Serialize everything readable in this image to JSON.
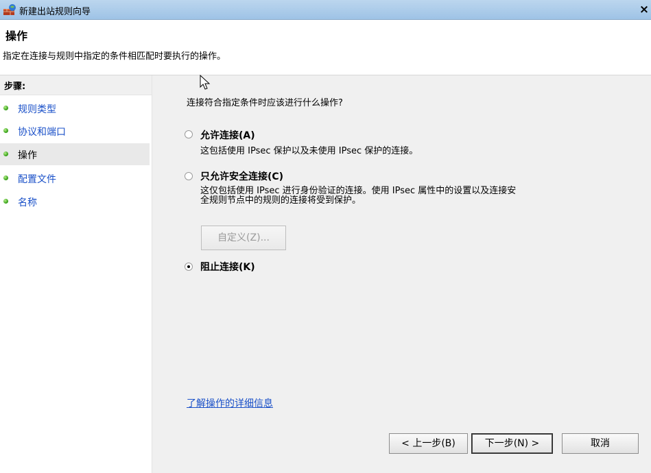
{
  "window": {
    "title": "新建出站规则向导",
    "close_symbol": "×"
  },
  "header": {
    "title": "操作",
    "description": "指定在连接与规则中指定的条件相匹配时要执行的操作。"
  },
  "sidebar": {
    "title": "步骤:",
    "items": [
      {
        "label": "规则类型",
        "active": false
      },
      {
        "label": "协议和端口",
        "active": false
      },
      {
        "label": "操作",
        "active": true
      },
      {
        "label": "配置文件",
        "active": false
      },
      {
        "label": "名称",
        "active": false
      }
    ]
  },
  "main": {
    "question": "连接符合指定条件时应该进行什么操作?",
    "options": [
      {
        "title": "允许连接(A)",
        "desc_lines": [
          "这包括使用 IPsec 保护以及未使用 IPsec 保护的连接。"
        ],
        "checked": false
      },
      {
        "title": "只允许安全连接(C)",
        "desc_lines": [
          "这仅包括使用 IPsec 进行身份验证的连接。使用 IPsec 属性中的设置以及连接安",
          "全规则节点中的规则的连接将受到保护。"
        ],
        "checked": false
      },
      {
        "title": "阻止连接(K)",
        "desc_lines": [],
        "checked": true
      }
    ],
    "customize_button": "自定义(Z)...",
    "learn_more_link": "了解操作的详细信息"
  },
  "footer": {
    "back_button": "< 上一步(B)",
    "next_button": "下一步(N) >",
    "cancel_button": "取消"
  }
}
